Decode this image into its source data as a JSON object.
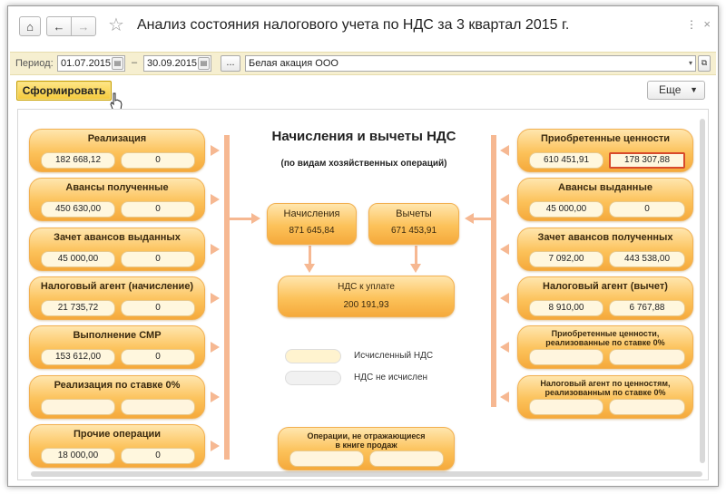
{
  "window": {
    "title": "Анализ состояния налогового учета по НДС за 3 квартал 2015 г.",
    "home_icon": "⌂",
    "back_icon": "←",
    "forward_icon": "→",
    "star_icon": "☆",
    "menu_dots": "⋮",
    "close_icon": "×"
  },
  "period": {
    "label": "Период:",
    "from": "01.07.2015",
    "to": "30.09.2015",
    "dash": "–",
    "ellipsis_button": "...",
    "organization": "Белая акация ООО"
  },
  "toolbar": {
    "generate_button": "Сформировать",
    "more_button": "Еще",
    "more_arrow": "▼"
  },
  "diagram": {
    "title": "Начисления и вычеты НДС",
    "subtitle": "(по видам хозяйственных операций)",
    "left": [
      {
        "title": "Реализация",
        "v1": "182 668,12",
        "v2": "0"
      },
      {
        "title": "Авансы полученные",
        "v1": "450 630,00",
        "v2": "0"
      },
      {
        "title": "Зачет авансов выданных",
        "v1": "45 000,00",
        "v2": "0"
      },
      {
        "title": "Налоговый агент (начисление)",
        "v1": "21 735,72",
        "v2": "0"
      },
      {
        "title": "Выполнение СМР",
        "v1": "153 612,00",
        "v2": "0"
      },
      {
        "title": "Реализация по ставке 0%",
        "v1": "",
        "v2": ""
      },
      {
        "title": "Прочие операции",
        "v1": "18 000,00",
        "v2": "0"
      }
    ],
    "right": [
      {
        "title": "Приобретенные ценности",
        "v1": "610 451,91",
        "v2": "178 307,88"
      },
      {
        "title": "Авансы выданные",
        "v1": "45 000,00",
        "v2": "0"
      },
      {
        "title": "Зачет авансов полученных",
        "v1": "7 092,00",
        "v2": "443 538,00"
      },
      {
        "title": "Налоговый агент (вычет)",
        "v1": "8 910,00",
        "v2": "6 767,88"
      },
      {
        "title": "Приобретенные ценности, реализованные по ставке 0%",
        "v1": "",
        "v2": ""
      },
      {
        "title": "Налоговый агент по ценностям, реализованным по ставке 0%",
        "v1": "",
        "v2": ""
      }
    ],
    "accruals": {
      "title": "Начисления",
      "value": "871 645,84"
    },
    "deductions": {
      "title": "Вычеты",
      "value": "671 453,91"
    },
    "payable": {
      "title": "НДС к уплате",
      "value": "200 191,93"
    },
    "not_reflected": {
      "title": "Операции, не отражающиеся в книге продаж"
    },
    "legend": [
      {
        "label": "Исчисленный НДС",
        "color": "#fff3cf"
      },
      {
        "label": "НДС не исчислен",
        "color": "#f1f1f1"
      }
    ]
  },
  "colors": {
    "card_fill": "#fcc25a",
    "connector": "#f6b892",
    "selected_border": "#d84a2a",
    "period_bar": "#f6efd0"
  }
}
